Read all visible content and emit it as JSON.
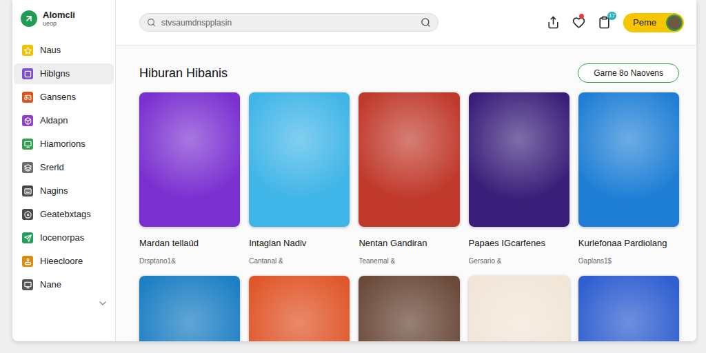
{
  "logo": {
    "name": "Alomcli",
    "tagline": "ueop"
  },
  "search": {
    "placeholder": "stvsaumdnspplasin"
  },
  "header": {
    "favorites": {
      "has_new": true
    },
    "notifications_badge": "17",
    "user": {
      "name": "Peme"
    }
  },
  "sidebar": {
    "items": [
      {
        "label": "Naus",
        "selected": false,
        "color": "#f2c200"
      },
      {
        "label": "Hiblgns",
        "selected": true,
        "color": "#7b4fd6"
      },
      {
        "label": "Gansens",
        "selected": false,
        "color": "#d9541e"
      },
      {
        "label": "Aldapn",
        "selected": false,
        "color": "#8e3fd1"
      },
      {
        "label": "Hiamorions",
        "selected": false,
        "color": "#2e9e4f"
      },
      {
        "label": "Srerld",
        "selected": false,
        "color": "#6b6b6b"
      },
      {
        "label": "Nagins",
        "selected": false,
        "color": "#4a4a4a"
      },
      {
        "label": "Geatebxtags",
        "selected": false,
        "color": "#4a4a4a"
      },
      {
        "label": "Iocenorpas",
        "selected": false,
        "color": "#22a05a"
      },
      {
        "label": "Hieecloore",
        "selected": false,
        "color": "#e08a10"
      },
      {
        "label": "Nane",
        "selected": false,
        "color": "#555555"
      }
    ]
  },
  "section": {
    "title": "Hiburan Hibanis",
    "button": "Garne 8o Naovens"
  },
  "cards": [
    {
      "title": "Mardan tellaúd",
      "subtitle": "Drsptano1&",
      "color": "#7a2fd0"
    },
    {
      "title": "Intaglan Nadiv",
      "subtitle": "Cantanal &",
      "color": "#3fb5e8"
    },
    {
      "title": "Nentan Gandiran",
      "subtitle": "Teanemal &",
      "color": "#c0392b"
    },
    {
      "title": "Papaes IGcarfenes",
      "subtitle": "Gersario &",
      "color": "#3a1f7a"
    },
    {
      "title": "Kurlefonaa Pardiolang",
      "subtitle": "Oaplans1$",
      "color": "#1f7fd6"
    }
  ],
  "more_cards": [
    {
      "color": "#1d7fc4"
    },
    {
      "color": "#e0572a"
    },
    {
      "color": "#6b4a3a"
    },
    {
      "color": "#f2e6d8"
    },
    {
      "color": "#2f5fd0"
    }
  ]
}
